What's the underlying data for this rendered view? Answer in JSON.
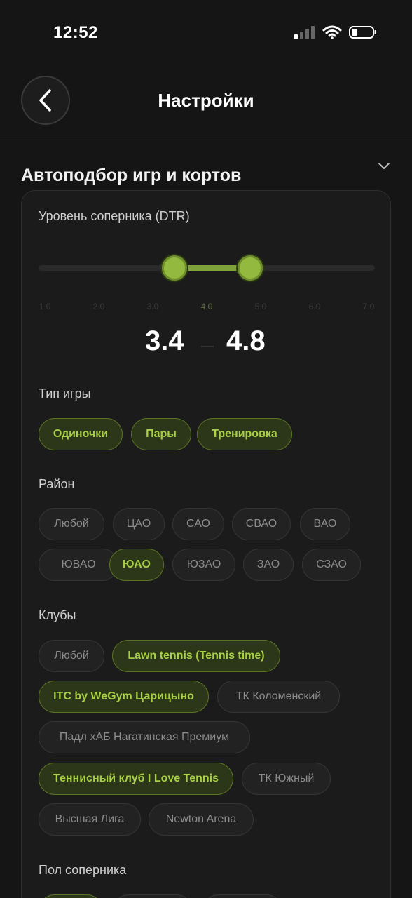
{
  "status": {
    "time": "12:52"
  },
  "nav": {
    "title": "Настройки"
  },
  "section": {
    "title": "Автоподбор игр и кортов"
  },
  "level": {
    "label": "Уровень соперника (DTR)",
    "ticks": [
      "1.0",
      "2.0",
      "3.0",
      "4.0",
      "5.0",
      "6.0",
      "7.0"
    ],
    "min": "3.4",
    "max": "4.8",
    "selected_range": [
      3.4,
      4.8
    ]
  },
  "game_type": {
    "label": "Тип игры",
    "options": [
      {
        "label": "Одиночки",
        "selected": true
      },
      {
        "label": "Пары",
        "selected": true
      },
      {
        "label": "Тренировка",
        "selected": true
      }
    ]
  },
  "district": {
    "label": "Район",
    "options": [
      {
        "label": "Любой",
        "selected": false
      },
      {
        "label": "ЦАО",
        "selected": false
      },
      {
        "label": "САО",
        "selected": false
      },
      {
        "label": "СВАО",
        "selected": false
      },
      {
        "label": "ВАО",
        "selected": false
      },
      {
        "label": "ЮВАО",
        "selected": false
      },
      {
        "label": "ЮАО",
        "selected": true
      },
      {
        "label": "ЮЗАО",
        "selected": false
      },
      {
        "label": "ЗАО",
        "selected": false
      },
      {
        "label": "СЗАО",
        "selected": false
      }
    ]
  },
  "clubs": {
    "label": "Клубы",
    "options": [
      {
        "label": "Любой",
        "selected": false
      },
      {
        "label": "Lawn tennis (Tennis time)",
        "selected": true
      },
      {
        "label": "ITC by WeGym Царицыно",
        "selected": true
      },
      {
        "label": "ТК Коломенский",
        "selected": false
      },
      {
        "label": "Падл хАБ Нагатинская Премиум",
        "selected": false
      },
      {
        "label": "Теннисный клуб I Love Tennis",
        "selected": true
      },
      {
        "label": "ТК Южный",
        "selected": false
      },
      {
        "label": "Высшая Лига",
        "selected": false
      },
      {
        "label": "Newton Arena",
        "selected": false
      }
    ]
  },
  "gender": {
    "label": "Пол соперника"
  },
  "colors": {
    "accent": "#a8d045",
    "background": "#151515",
    "card": "#1b1b1b"
  }
}
